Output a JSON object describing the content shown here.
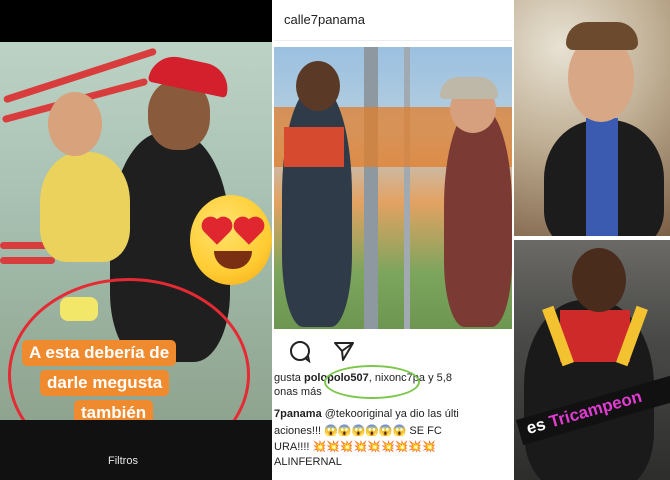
{
  "story": {
    "sticker_lines": [
      "A esta debería de",
      "darle megusta",
      "también"
    ],
    "filters_label": "Filtros",
    "colors": {
      "sticker": "#f08a2e",
      "circle": "#e52a33"
    },
    "emoji": "heart-eyes-emoji"
  },
  "post": {
    "account": "calle7panama",
    "likes": {
      "prefix": "gusta ",
      "highlighted_user": "polopolo507",
      "rest": ", ni",
      "other_user": "xonc7pa",
      "tail": " y 5,8",
      "line2": "onas más"
    },
    "caption": {
      "line1_user": "7panama",
      "line1_text": " @tekooriginal ya dio las últi",
      "line2": "aciones!!! 😱😱😱😱😱😱 SE FC",
      "line3": "URA!!!! 💥💥💥💥💥💥💥💥💥",
      "line4": "ALINFERNAL"
    },
    "icons": [
      "comment-icon",
      "share-icon"
    ],
    "highlight_color": "#7bc74d"
  },
  "right_bottom": {
    "overlay_prefix": "es ",
    "overlay_accent": "Tricampeon"
  }
}
